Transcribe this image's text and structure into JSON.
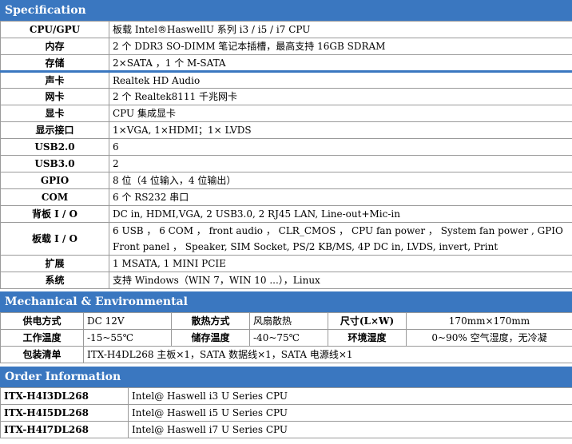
{
  "sections": {
    "spec": "Specification",
    "mech": "Mechanical & Environmental",
    "order": "Order Information"
  },
  "spec_rows": [
    {
      "label": "CPU/GPU",
      "value": "板载 Intel®HaswellU 系列 i3 / i5 / i7 CPU"
    },
    {
      "label": "内存",
      "value": "2 个 DDR3 SO-DIMM 笔记本插槽，最高支持 16GB SDRAM"
    },
    {
      "label": "存储",
      "value": "2×SATA ，1 个 M-SATA"
    },
    {
      "label": "声卡",
      "value": "Realtek HD Audio"
    },
    {
      "label": "网卡",
      "value": "2 个 Realtek8111 千兆网卡"
    },
    {
      "label": "显卡",
      "value": "CPU 集成显卡"
    },
    {
      "label": "显示接口",
      "value": "1×VGA, 1×HDMI；1× LVDS"
    },
    {
      "label": "USB2.0",
      "value": "6"
    },
    {
      "label": "USB3.0",
      "value": "2"
    },
    {
      "label": "GPIO",
      "value": "8 位（4 位输入，4 位输出）"
    },
    {
      "label": "COM",
      "value": "6 个 RS232 串口"
    },
    {
      "label": "背板 I / O",
      "value": "DC in, HDMI,VGA, 2 USB3.0,   2 RJ45 LAN,    Line-out+Mic-in"
    },
    {
      "label": "板载 I / O",
      "value": "6 USB ，  6 COM ，   front audio ，   CLR_CMOS ，   CPU fan power ，   System fan power , GPIO",
      "value2": "Front panel ，   Speaker,    SIM Socket,    PS/2 KB/MS,     4P DC in,     LVDS,     invert,     Print"
    },
    {
      "label": "扩展",
      "value": "1 MSATA,    1 MINI PCIE"
    },
    {
      "label": "系统",
      "value": " 支持 Windows（WIN 7，WIN 10 ...），Linux"
    }
  ],
  "mech": {
    "power_label": "供电方式",
    "power_value": "DC 12V",
    "cool_label": "散热方式",
    "cool_value": "风扇散热",
    "size_label": "尺寸(L×W)",
    "size_value": "170mm×170mm",
    "worktemp_label": "工作温度",
    "worktemp_value": "-15~55℃",
    "storetemp_label": "储存温度",
    "storetemp_value": "-40~75℃",
    "humidity_label": "环境湿度",
    "humidity_value": "0~90% 空气湿度，无冷凝",
    "pack_label": "包装清单",
    "pack_value": "ITX-H4DL268 主板×1，SATA 数据线×1，SATA 电源线×1"
  },
  "order_rows": [
    {
      "model": "ITX-H4I3DL268",
      "desc": "Intel@ Haswell i3 U Series CPU"
    },
    {
      "model": "ITX-H4I5DL268",
      "desc": "Intel@ Haswell i5 U Series CPU"
    },
    {
      "model": "ITX-H4I7DL268",
      "desc": "Intel@ Haswell i7 U Series CPU"
    }
  ]
}
